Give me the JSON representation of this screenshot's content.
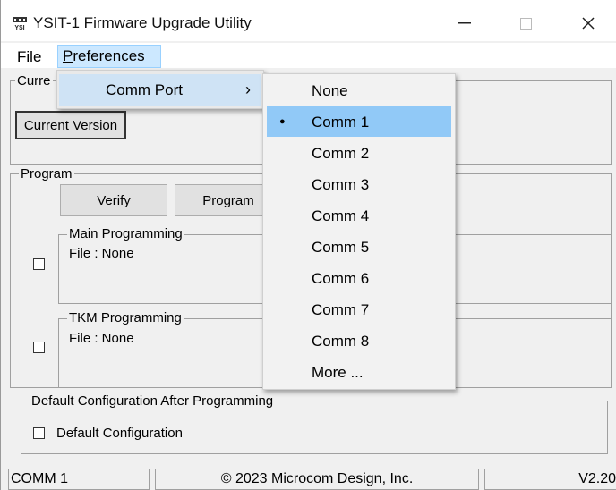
{
  "window": {
    "title": "YSIT-1 Firmware Upgrade Utility",
    "minimize_glyph": "—",
    "maximize_glyph": "☐",
    "close_glyph": "✕"
  },
  "menubar": {
    "file_prefix": "",
    "file_hotkey": "F",
    "file_rest": "ile",
    "pref_hotkey": "P",
    "pref_rest": "references"
  },
  "current_group": {
    "label_partial": "Curre",
    "current_version_button": "Current Version"
  },
  "program_group": {
    "label": "Program",
    "verify_button": "Verify",
    "program_button": "Program"
  },
  "main_programming": {
    "label": "Main Programming",
    "file_text": "File :  None",
    "checked": false
  },
  "tkm_programming": {
    "label": "TKM Programming",
    "file_text": "File :  None",
    "checked": false
  },
  "default_config_group": {
    "label": "Default Configuration After Programming",
    "checkbox_label": "Default Configuration",
    "checked": false
  },
  "status_bar": {
    "port": "COMM 1",
    "copyright": "© 2023 Microcom Design, Inc.",
    "version": "V2.20"
  },
  "preferences_menu": {
    "items": [
      {
        "label": "Comm Port",
        "arrow": "›"
      }
    ]
  },
  "comm_port_submenu": {
    "selected_index": 1,
    "bullet": "●",
    "items": [
      "None",
      "Comm 1",
      "Comm 2",
      "Comm 3",
      "Comm 4",
      "Comm 5",
      "Comm 6",
      "Comm 7",
      "Comm 8",
      "More ..."
    ]
  },
  "colors": {
    "highlight": "#91c9f7",
    "menu_active_bg": "#cce8ff",
    "window_bg": "#f0f0f0"
  }
}
